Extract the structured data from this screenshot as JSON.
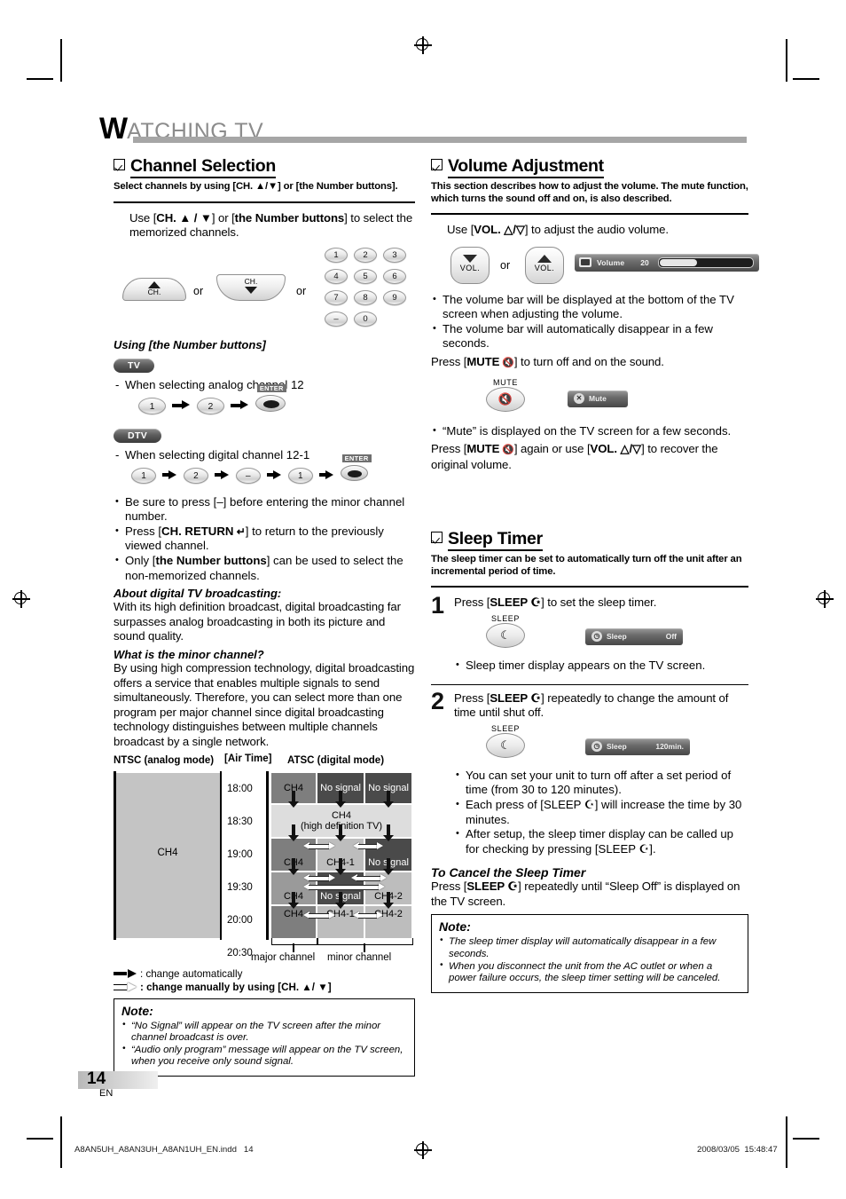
{
  "chapter": {
    "initial": "W",
    "rest": "ATCHING  TV"
  },
  "left": {
    "section": {
      "title": "Channel Selection",
      "subtitle": "Select channels by using [CH. ▲/▼] or [the Number buttons]."
    },
    "intro": "Use [CH. ▲ / ▼] or [the Number buttons] to select the memorized channels.",
    "intro_parts": {
      "a": "Use [",
      "b1": "CH. ▲ / ▼",
      "c": "] or [",
      "b2": "the Number buttons",
      "d": "] to select the memorized channels."
    },
    "or_1": "or",
    "or_2": "or",
    "ch_up_label": "CH.",
    "ch_down_label": "CH.",
    "numpad": [
      [
        "1",
        "2",
        "3"
      ],
      [
        "4",
        "5",
        "6"
      ],
      [
        "7",
        "8",
        "9"
      ],
      [
        "–",
        "0"
      ]
    ],
    "using_numbers_heading": "Using [the Number buttons]",
    "badge_tv": "TV",
    "badge_dtv": "DTV",
    "analog_line": "When selecting analog channel 12",
    "analog_keys": [
      "1",
      "2"
    ],
    "digital_line": "When selecting digital channel 12-1",
    "digital_keys": [
      "1",
      "2",
      "–",
      "1"
    ],
    "enter_label": "ENTER",
    "bullets": [
      "Be sure to press [–] before entering the minor channel number.",
      "Press [CH. RETURN ↩] to return to the previously viewed channel.",
      "Only [the Number buttons] can be used to select the non-memorized channels."
    ],
    "bullet2_parts": {
      "pre": "Press [",
      "b": "CH. RETURN",
      "post": "] to return to the previously viewed channel."
    },
    "bullet3_parts": {
      "pre": "Only [",
      "b": "the Number buttons",
      "post": "] can be used to select the non-memorized channels."
    },
    "about_heading": "About digital TV broadcasting:",
    "about_body": "With its high definition broadcast, digital broadcasting far surpasses analog broadcasting in both its picture and sound quality.",
    "minor_heading": "What is the minor channel?",
    "minor_body": "By using high compression technology, digital broadcasting offers a service that enables multiple signals to send simultaneously. Therefore, you can select more than one program per major channel since digital broadcasting technology distinguishes between multiple channels broadcast by a single network.",
    "diagram": {
      "left_header": "NTSC (analog mode)",
      "center_header": "[Air Time]",
      "right_header": "ATSC (digital mode)",
      "times": [
        "18:00",
        "18:30",
        "19:00",
        "19:30",
        "20:00",
        "20:30"
      ],
      "ntsc_label": "CH4",
      "atsc_rows": [
        [
          "CH4",
          "No signal",
          "No signal"
        ],
        [
          "CH4 (high definition TV)"
        ],
        [
          "CH4",
          "CH4-1",
          "No signal"
        ],
        [
          "CH4",
          "No signal",
          "CH4-2"
        ],
        [
          "CH4",
          "CH4-1",
          "CH4-2"
        ]
      ],
      "hd_label_line1": "CH4",
      "hd_label_line2": "(high definition TV)",
      "bracket_major": "major channel",
      "bracket_minor": "minor channel"
    },
    "legend": [
      ": change automatically",
      ": change manually by using [CH. ▲/ ▼]"
    ],
    "note": {
      "title": "Note:",
      "items": [
        "“No Signal” will appear on the TV screen after the minor channel broadcast is over.",
        "“Audio only program” message will appear on the TV screen, when you receive only sound signal."
      ]
    }
  },
  "right": {
    "volume": {
      "title": "Volume Adjustment",
      "subtitle": "This section describes how to adjust the volume. The mute function, which turns the sound off and on, is also described.",
      "use_line_parts": {
        "pre": "Use [",
        "b": "VOL. △/▽",
        "post": "] to adjust the audio volume."
      },
      "or": "or",
      "vol_key_down_label": "VOL.",
      "vol_key_up_label": "VOL.",
      "osd": {
        "label": "Volume",
        "value": "20",
        "fill_percent": 40
      },
      "bullets": [
        "The volume bar will be displayed at the bottom of the TV screen when adjusting the volume.",
        "The volume bar will automatically disappear in a few seconds."
      ],
      "mute_press_parts": {
        "pre": "Press [",
        "b": "MUTE",
        "post": "] to turn off and on the sound."
      },
      "mute_key_label": "MUTE",
      "mute_osd_label": "Mute",
      "mute_bullet": "“Mute” is displayed on the TV screen for a few seconds.",
      "mute_recover_parts": {
        "pre": "Press [",
        "b1": "MUTE",
        "mid": "] again or use [",
        "b2": "VOL. △/▽",
        "post": "] to recover the original volume."
      }
    },
    "sleep": {
      "title": "Sleep Timer",
      "subtitle": "The sleep timer can be set to automatically turn off the unit after an incremental period of time.",
      "steps": [
        {
          "num": "1",
          "text_parts": {
            "pre": "Press [",
            "b": "SLEEP ☪",
            "post": "] to set the sleep timer."
          },
          "key_label": "SLEEP",
          "osd": {
            "label": "Sleep",
            "value": "Off"
          },
          "bullets": [
            "Sleep timer display appears on the TV screen."
          ]
        },
        {
          "num": "2",
          "text_parts": {
            "pre": "Press [",
            "b": "SLEEP ☪",
            "post": "] repeatedly to change the amount of time until shut off."
          },
          "key_label": "SLEEP",
          "osd": {
            "label": "Sleep",
            "value": "120min."
          },
          "bullets": [
            "You can set your unit to turn off after a set period of time (from 30 to 120 minutes).",
            "Each press of [SLEEP ☪] will increase the time by 30 minutes.",
            "After setup, the sleep timer display can be called up for checking by pressing [SLEEP ☪]."
          ]
        }
      ],
      "cancel_heading": "To Cancel the Sleep Timer",
      "cancel_body_parts": {
        "pre": "Press [",
        "b": "SLEEP ☪",
        "post": "] repeatedly until “Sleep Off” is displayed on the TV screen."
      },
      "note": {
        "title": "Note:",
        "items": [
          "The sleep timer display will automatically disappear in a few seconds.",
          "When you disconnect the unit from the AC outlet or when a power failure occurs, the sleep timer setting will be canceled."
        ]
      }
    }
  },
  "footer": {
    "page_number": "14",
    "language": "EN",
    "filename": "A8AN5UH_A8AN3UH_A8AN1UH_EN.indd",
    "file_page": "14",
    "date": "2008/03/05",
    "time": "15:48:47"
  }
}
